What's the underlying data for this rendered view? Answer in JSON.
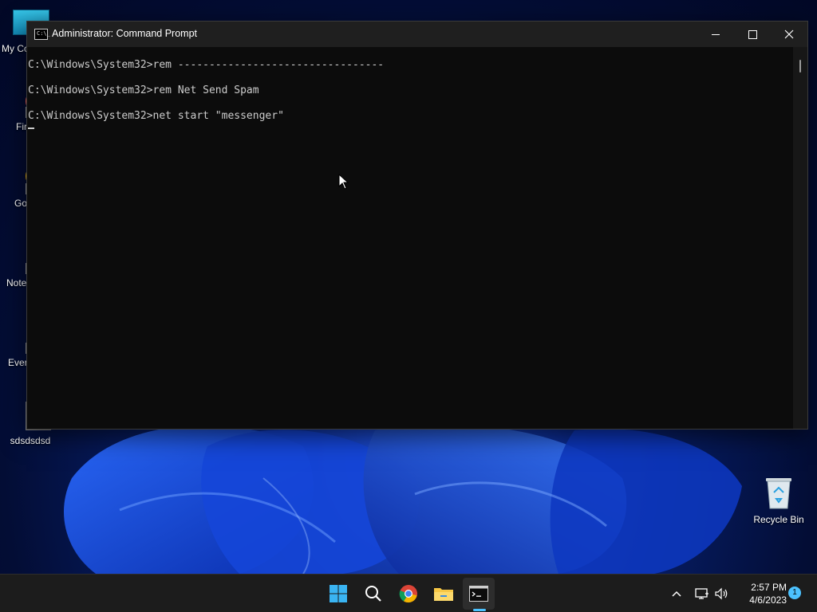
{
  "window": {
    "title": "Administrator: Command Prompt",
    "console_lines": [
      "C:\\Windows\\System32>rem ---------------------------------",
      "C:\\Windows\\System32>rem Net Send Spam",
      "C:\\Windows\\System32>net start \"messenger\""
    ]
  },
  "desktop_icons": [
    {
      "label": "My Co",
      "icon": "computer-icon"
    },
    {
      "label": "Fir",
      "icon": "firefox-icon"
    },
    {
      "label": "Go Chr",
      "icon": "chrome-icon"
    },
    {
      "label": "Note",
      "icon": "notepad-icon"
    },
    {
      "label": "Ever",
      "icon": "everything-icon"
    },
    {
      "label": "sdsdsdsd",
      "icon": "file-icon"
    }
  ],
  "recycle_bin": {
    "label": "Recycle Bin",
    "icon": "recycle-bin-icon"
  },
  "taskbar": {
    "apps": [
      "start-icon",
      "search-icon",
      "chrome-icon",
      "file-explorer-icon",
      "command-prompt-icon"
    ],
    "time": "2:57 PM",
    "date": "4/6/2023",
    "notification_count": "1"
  },
  "colors": {
    "console_bg": "#0c0c0c",
    "console_text": "#cccccc",
    "titlebar": "#1f1f1f",
    "taskbar": "#1c1c1c",
    "accent": "#4cc2ff"
  }
}
